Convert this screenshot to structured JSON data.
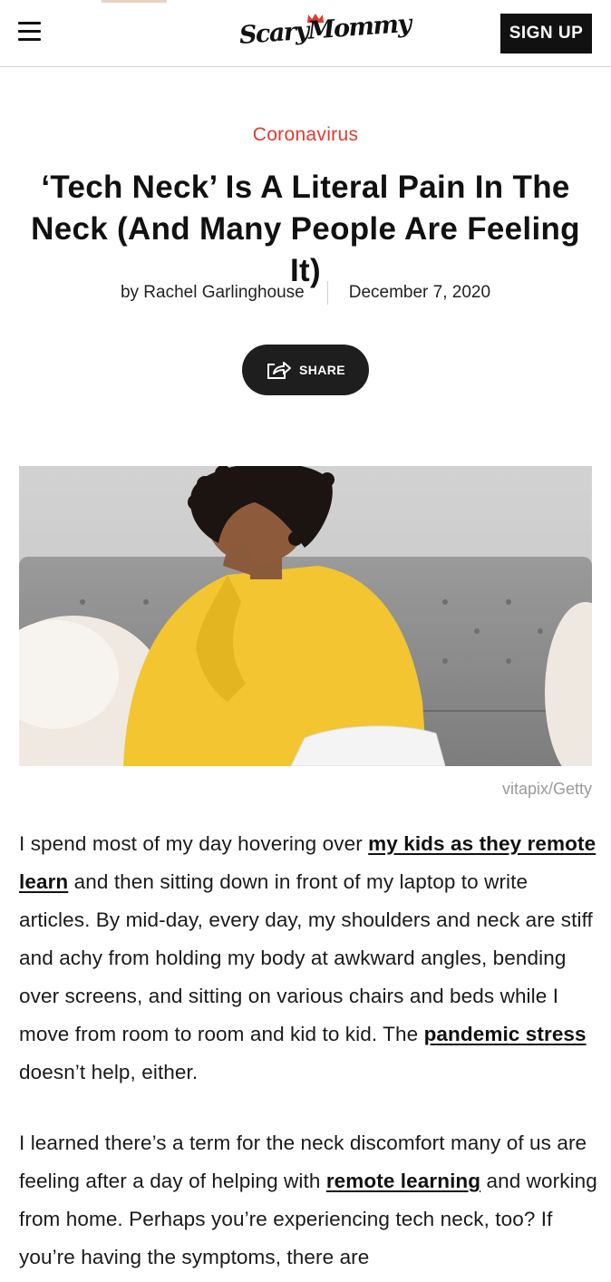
{
  "header": {
    "logo_text": "ScaryMommy",
    "signup_label": "SIGN UP"
  },
  "article": {
    "category": "Coronavirus",
    "title": "‘Tech Neck’ Is A Literal Pain In The Neck (And Many People Are Feeling It)",
    "author": "by Rachel Garlinghouse",
    "date": "December 7, 2020",
    "share_label": "SHARE",
    "image_credit": "vitapix/Getty",
    "paragraph1": {
      "t1": "I spend most of my day hovering over ",
      "link1": "my kids as they remote learn",
      "t2": " and then sitting down in front of my laptop to write articles. By mid-day, every day, my shoulders and neck are stiff and achy from holding my body at awkward angles, bending over screens, and sitting on various chairs and beds while I move from room to room and kid to kid. The ",
      "link2": "pandemic stress",
      "t3": " doesn’t help, either."
    },
    "paragraph2": {
      "t1": "I learned there’s a term for the neck discomfort many of us are feeling after a day of helping with ",
      "link1": "remote learning",
      "t2": " and working from home. Perhaps you’re experiencing tech neck, too? If you’re having the symptoms, there are"
    }
  },
  "icons": [
    "hamburger-menu-icon",
    "crown-icon",
    "share-icon"
  ],
  "colors": {
    "accent": "#e23a2f",
    "dark": "#111111",
    "background": "#ffffff"
  }
}
